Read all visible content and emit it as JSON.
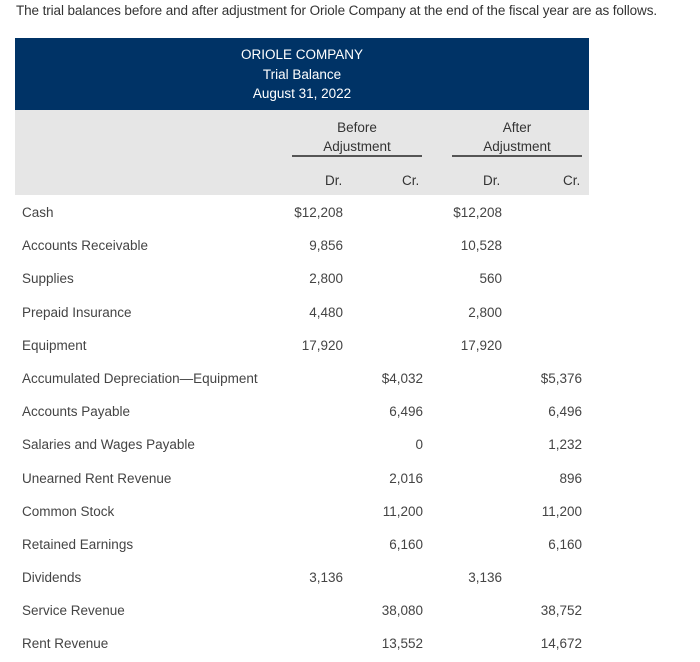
{
  "intro": "The trial balances before and after adjustment for Oriole Company at the end of the fiscal year are as follows.",
  "header": {
    "company": "ORIOLE COMPANY",
    "statement": "Trial Balance",
    "date": "August 31, 2022"
  },
  "columns": {
    "before_line1": "Before",
    "before_line2": "Adjustment",
    "after_line1": "After",
    "after_line2": "Adjustment",
    "dr": "Dr.",
    "cr": "Cr."
  },
  "accounts": [
    {
      "name": "Cash",
      "before_dr": "$12,208",
      "before_cr": "",
      "after_dr": "$12,208",
      "after_cr": ""
    },
    {
      "name": "Accounts Receivable",
      "before_dr": "9,856",
      "before_cr": "",
      "after_dr": "10,528",
      "after_cr": ""
    },
    {
      "name": "Supplies",
      "before_dr": "2,800",
      "before_cr": "",
      "after_dr": "560",
      "after_cr": ""
    },
    {
      "name": "Prepaid Insurance",
      "before_dr": "4,480",
      "before_cr": "",
      "after_dr": "2,800",
      "after_cr": ""
    },
    {
      "name": "Equipment",
      "before_dr": "17,920",
      "before_cr": "",
      "after_dr": "17,920",
      "after_cr": ""
    },
    {
      "name": "Accumulated Depreciation—Equipment",
      "before_dr": "",
      "before_cr": "$4,032",
      "after_dr": "",
      "after_cr": "$5,376"
    },
    {
      "name": "Accounts Payable",
      "before_dr": "",
      "before_cr": "6,496",
      "after_dr": "",
      "after_cr": "6,496"
    },
    {
      "name": "Salaries and Wages Payable",
      "before_dr": "",
      "before_cr": "0",
      "after_dr": "",
      "after_cr": "1,232"
    },
    {
      "name": "Unearned Rent Revenue",
      "before_dr": "",
      "before_cr": "2,016",
      "after_dr": "",
      "after_cr": "896"
    },
    {
      "name": "Common Stock",
      "before_dr": "",
      "before_cr": "11,200",
      "after_dr": "",
      "after_cr": "11,200"
    },
    {
      "name": "Retained Earnings",
      "before_dr": "",
      "before_cr": "6,160",
      "after_dr": "",
      "after_cr": "6,160"
    },
    {
      "name": "Dividends",
      "before_dr": "3,136",
      "before_cr": "",
      "after_dr": "3,136",
      "after_cr": ""
    },
    {
      "name": "Service Revenue",
      "before_dr": "",
      "before_cr": "38,080",
      "after_dr": "",
      "after_cr": "38,752"
    },
    {
      "name": "Rent Revenue",
      "before_dr": "",
      "before_cr": "13,552",
      "after_dr": "",
      "after_cr": "14,672"
    }
  ]
}
